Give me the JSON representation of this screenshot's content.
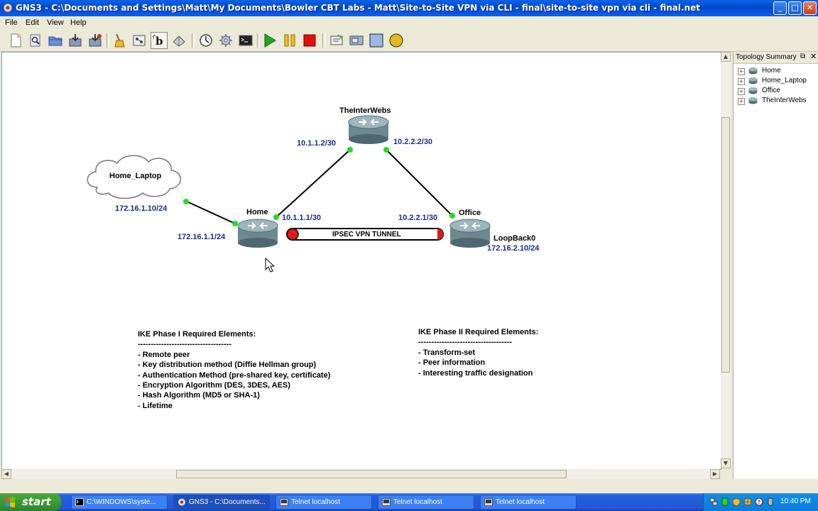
{
  "window": {
    "title": "GNS3 - C:\\Documents and Settings\\Matt\\My Documents\\Bowler CBT Labs - Matt\\Site-to-Site VPN via CLI - final\\site-to-site vpn via cli - final.net",
    "min_label": "_",
    "max_label": "□",
    "close_label": "✕"
  },
  "menu": {
    "file": "File",
    "edit": "Edit",
    "view": "View",
    "help": "Help"
  },
  "toolbar": {
    "icons": [
      "new-icon",
      "open-icon",
      "open-folder-icon",
      "save-icon",
      "save-as-icon",
      "clear-icon",
      "snapshot-icon",
      "label-icon",
      "screenshot-icon",
      "idle-pc-icon",
      "settings-icon",
      "console-icon",
      "start-icon",
      "suspend-icon",
      "stop-icon",
      "note-icon",
      "picture-icon",
      "rectangle-icon",
      "ellipse-icon"
    ],
    "start_color": "#22a81e",
    "suspend_color": "#f0c020",
    "stop_color": "#e01010"
  },
  "diagram": {
    "nodes": {
      "interwebs": "TheInterWebs",
      "home": "Home",
      "office": "Office",
      "laptop": "Home_Laptop",
      "loopback": "LoopBack0"
    },
    "interfaces": {
      "interwebs_left": "10.1.1.2/30",
      "interwebs_right": "10.2.2.2/30",
      "home_up": "10.1.1.1/30",
      "office_up": "10.2.2.1/30",
      "laptop": "172.16.1.10/24",
      "home_lan": "172.16.1.1/24",
      "loopback": "172.16.2.10/24"
    },
    "tunnel_label": "IPSEC VPN TUNNEL",
    "link_dot_color": "#22dd22",
    "ip_label_color": "#1c2c8c"
  },
  "notes": {
    "phase1": {
      "heading": "IKE Phase I Required Elements:",
      "rule": "------------------------------------",
      "items": [
        "- Remote peer",
        "- Key distribution method (Diffie Hellman group)",
        "- Authentication Method (pre-shared key, certificate)",
        "- Encryption Algorithm (DES, 3DES, AES)",
        "- Hash Algorithm (MD5 or SHA-1)",
        "- Lifetime"
      ]
    },
    "phase2": {
      "heading": "IKE Phase II Required Elements:",
      "rule": "------------------------------------",
      "items": [
        "- Transform-set",
        "- Peer information",
        "- Interesting traffic designation"
      ]
    }
  },
  "topology_summary": {
    "title": "Topology Summary",
    "items": [
      "Home",
      "Home_Laptop",
      "Office",
      "TheInterWebs"
    ]
  },
  "taskbar": {
    "start_label": "start",
    "tasks": [
      "C:\\WINDOWS\\syste...",
      "GNS3 - C:\\Documents...",
      "Telnet localhost",
      "Telnet localhost",
      "Telnet localhost"
    ],
    "clock": "10:40 PM"
  }
}
